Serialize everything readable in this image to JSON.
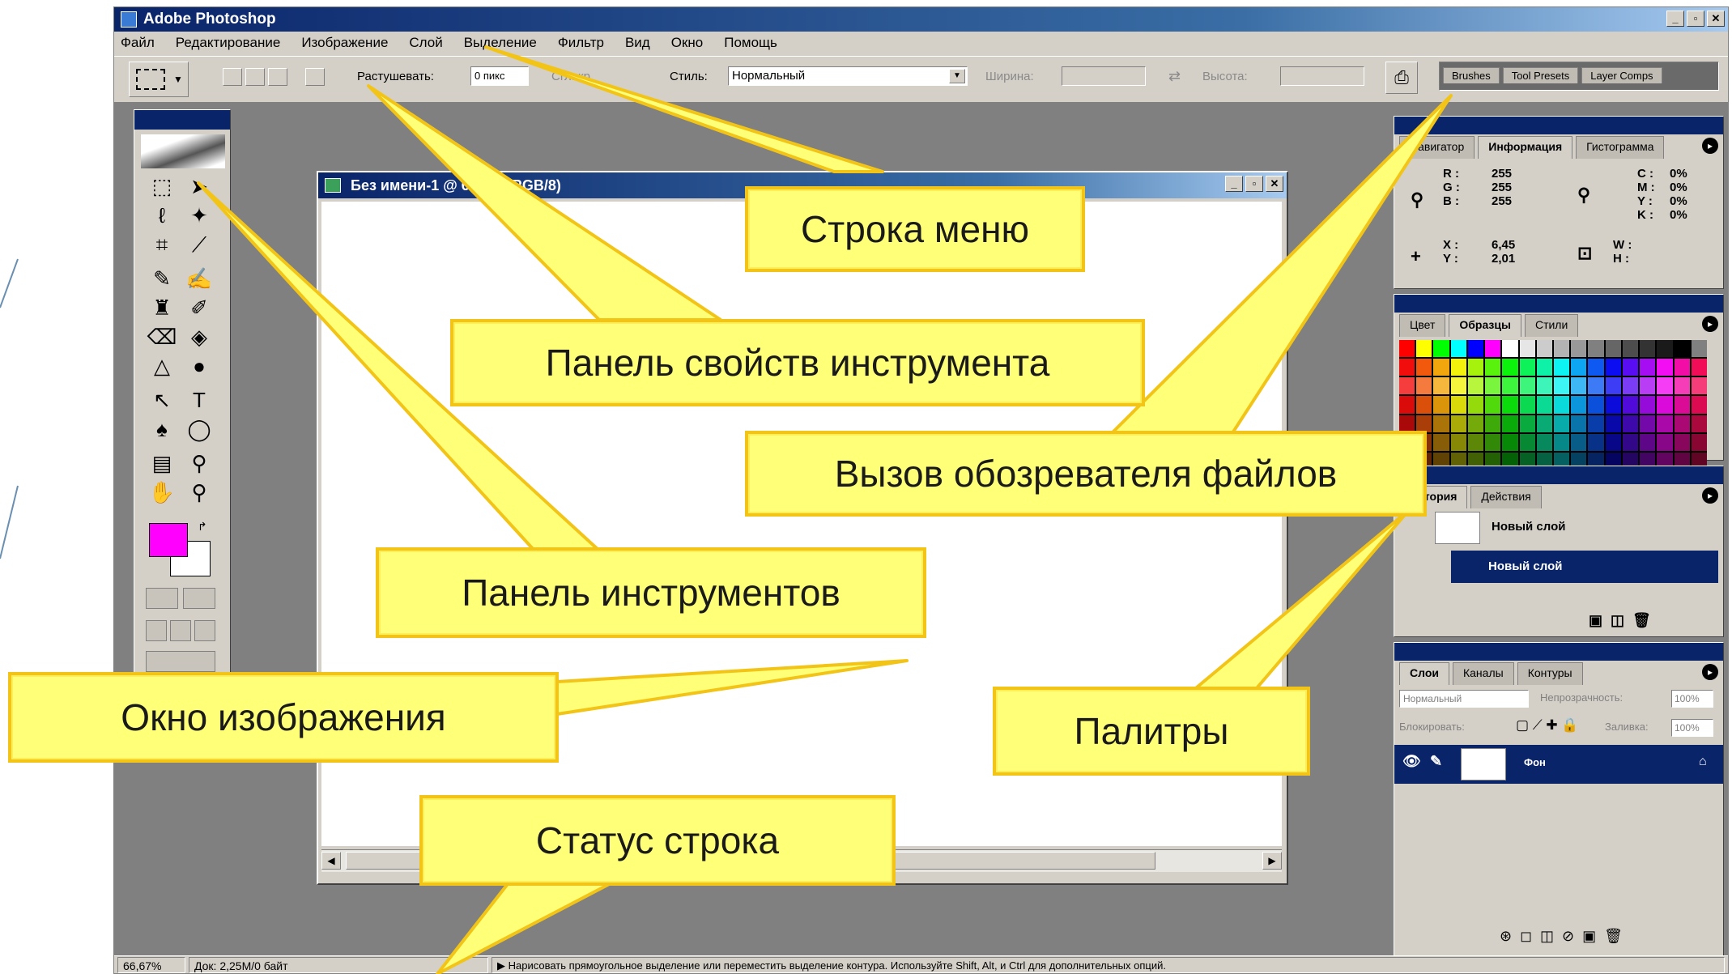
{
  "app": {
    "title": "Adobe Photoshop"
  },
  "menu": [
    "Файл",
    "Редактирование",
    "Изображение",
    "Слой",
    "Выделение",
    "Фильтр",
    "Вид",
    "Окно",
    "Помощь"
  ],
  "options": {
    "feather_label": "Растушевать:",
    "feather_value": "0 пикс",
    "antialias_label": "Сгл. кр.",
    "style_label": "Стиль:",
    "style_value": "Нормальный",
    "width_label": "Ширина:",
    "height_label": "Высота:",
    "well_tabs": [
      "Brushes",
      "Tool Presets",
      "Layer Comps"
    ]
  },
  "document": {
    "title": "Без имени-1 @ 66,7% (RGB/8)"
  },
  "palettes": {
    "info": {
      "tabs": [
        "Навигатор",
        "Информация",
        "Гистограмма"
      ],
      "rgb_labels": "R :\nG :\nB :",
      "rgb_values": "255\n255\n255",
      "cmyk_labels": "C :\nM :\nY :\nK :",
      "cmyk_values": "0%\n0%\n0%\n0%",
      "xy_labels": "X :\nY :",
      "xy_values": "6,45\n2,01",
      "wh_labels": "W :\nH :"
    },
    "swatches": {
      "tabs": [
        "Цвет",
        "Образцы",
        "Стили"
      ],
      "colors": [
        "#ff0000",
        "#ffff00",
        "#00ff00",
        "#00ffff",
        "#0000ff",
        "#ff00ff",
        "#ffffff",
        "#e6e6e6",
        "#cccccc",
        "#b3b3b3",
        "#999999",
        "#808080",
        "#666666",
        "#4d4d4d",
        "#333333",
        "#1a1a1a",
        "#000000",
        "#808080"
      ]
    },
    "history": {
      "tabs": [
        "История",
        "Действия"
      ],
      "snapshot": "Новый слой",
      "state": "Новый слой"
    },
    "layers": {
      "tabs": [
        "Слои",
        "Каналы",
        "Контуры"
      ],
      "blend_mode": "Нормальный",
      "opacity_label": "Непрозрачность:",
      "opacity_value": "100%",
      "lock_label": "Блокировать:",
      "fill_label": "Заливка:",
      "fill_value": "100%",
      "layer_name": "Фон"
    }
  },
  "status": {
    "zoom": "66,67%",
    "doc_size": "Док: 2,25M/0 байт",
    "hint": "Нарисовать прямоугольное выделение или переместить выделение контура. Используйте Shift, Alt, и Ctrl для дополнительных опций."
  },
  "callouts": {
    "menu_bar": "Строка меню",
    "options_bar": "Панель свойств инструмента",
    "file_browser": "Вызов обозревателя файлов",
    "toolbox": "Панель инструментов",
    "image_window": "Окно изображения",
    "palettes": "Палитры",
    "status_bar": "Статус строка"
  }
}
